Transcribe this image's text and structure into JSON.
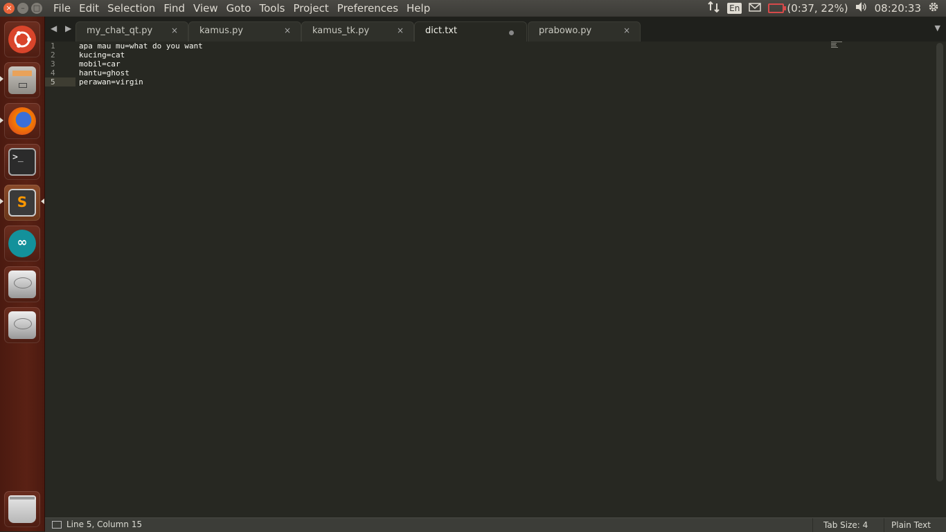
{
  "window_controls": {
    "close": "×",
    "minimize": "–",
    "maximize": "□"
  },
  "menu": [
    "File",
    "Edit",
    "Selection",
    "Find",
    "View",
    "Goto",
    "Tools",
    "Project",
    "Preferences",
    "Help"
  ],
  "indicators": {
    "language": "En",
    "battery_text": "(0:37, 22%)",
    "clock": "08:20:33"
  },
  "launcher": [
    {
      "name": "ubuntu-dash"
    },
    {
      "name": "files"
    },
    {
      "name": "firefox"
    },
    {
      "name": "terminal"
    },
    {
      "name": "sublime-text"
    },
    {
      "name": "arduino"
    },
    {
      "name": "drive-1"
    },
    {
      "name": "drive-2"
    },
    {
      "name": "trash"
    }
  ],
  "tabs": [
    {
      "label": "my_chat_qt.py",
      "close": "×"
    },
    {
      "label": "kamus.py",
      "close": "×"
    },
    {
      "label": "kamus_tk.py",
      "close": "×"
    },
    {
      "label": "dict.txt",
      "modified": true
    },
    {
      "label": "prabowo.py",
      "close": "×"
    }
  ],
  "tab_nav": "◀ ▶",
  "tab_menu": "▼",
  "editor": {
    "lines": [
      {
        "num": "1",
        "text": "apa mau mu=what do you want"
      },
      {
        "num": "2",
        "text": "kucing=cat"
      },
      {
        "num": "3",
        "text": "mobil=car"
      },
      {
        "num": "4",
        "text": "hantu=ghost"
      },
      {
        "num": "5",
        "text": "perawan=virgin"
      }
    ],
    "current_line": 5
  },
  "status": {
    "position": "Line 5, Column 15",
    "tab_size": "Tab Size: 4",
    "syntax": "Plain Text"
  },
  "colors": {
    "editor_bg": "#272822",
    "launcher_bg": "#5a2114",
    "accent_close": "#e9653b",
    "battery_low": "#d64a4a"
  }
}
